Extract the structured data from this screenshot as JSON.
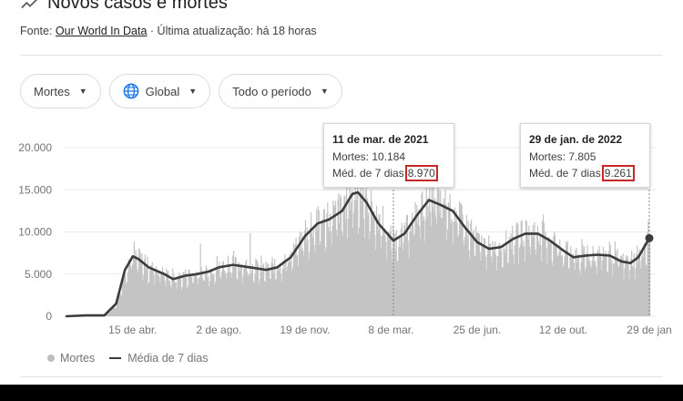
{
  "header": {
    "title": "Novos casos e mortes",
    "source_prefix": "Fonte:",
    "source_link": "Our World In Data",
    "source_suffix": "· Última atualização: há 18 horas",
    "icon": "trending-line-icon"
  },
  "filters": [
    {
      "label": "Mortes",
      "icon": ""
    },
    {
      "label": "Global",
      "icon": "globe-icon"
    },
    {
      "label": "Todo o período",
      "icon": ""
    }
  ],
  "colors": {
    "bars": "#c4c4c4",
    "line": "#3c3c3c",
    "highlight": "#c62828",
    "text": "#70757a"
  },
  "tooltips": [
    {
      "date": "11 de mar. de 2021",
      "line1_label": "Mortes:",
      "line1_value": "10.184",
      "line2_label": "Méd. de 7 dias",
      "line2_value": "8.970"
    },
    {
      "date": "29 de jan. de 2022",
      "line1_label": "Mortes:",
      "line1_value": "7.805",
      "line2_label": "Méd. de 7 dias",
      "line2_value": "9.261"
    }
  ],
  "legend": {
    "bars_label": "Mortes",
    "line_label": "Média de 7 dias"
  },
  "chart_data": {
    "type": "bar",
    "x_range": [
      "2020-01-22",
      "2022-01-29"
    ],
    "ylim": [
      0,
      20000
    ],
    "y_ticks": [
      "0",
      "5.000",
      "10.000",
      "15.000",
      "20.000"
    ],
    "x_ticks": [
      {
        "label": "15 de abr.",
        "date": "2020-04-15"
      },
      {
        "label": "2 de ago.",
        "date": "2020-08-02"
      },
      {
        "label": "19 de nov.",
        "date": "2020-11-19"
      },
      {
        "label": "8 de mar.",
        "date": "2021-03-08"
      },
      {
        "label": "25 de jun.",
        "date": "2021-06-25"
      },
      {
        "label": "12 de out.",
        "date": "2021-10-12"
      },
      {
        "label": "29 de jan",
        "date": "2022-01-29"
      }
    ],
    "grid": "horizontal",
    "series": [
      {
        "name": "Mortes",
        "type": "bar"
      },
      {
        "name": "Média de 7 dias",
        "type": "line",
        "points": [
          [
            "2020-01-22",
            0
          ],
          [
            "2020-02-15",
            100
          ],
          [
            "2020-03-10",
            100
          ],
          [
            "2020-03-25",
            1500
          ],
          [
            "2020-04-05",
            5500
          ],
          [
            "2020-04-15",
            7100
          ],
          [
            "2020-04-22",
            6800
          ],
          [
            "2020-05-05",
            5800
          ],
          [
            "2020-05-25",
            5000
          ],
          [
            "2020-06-05",
            4400
          ],
          [
            "2020-06-20",
            4800
          ],
          [
            "2020-07-05",
            5000
          ],
          [
            "2020-07-20",
            5300
          ],
          [
            "2020-08-02",
            5800
          ],
          [
            "2020-08-20",
            6100
          ],
          [
            "2020-09-10",
            5800
          ],
          [
            "2020-10-01",
            5500
          ],
          [
            "2020-10-15",
            5800
          ],
          [
            "2020-11-01",
            7000
          ],
          [
            "2020-11-19",
            9500
          ],
          [
            "2020-12-05",
            11000
          ],
          [
            "2020-12-20",
            11500
          ],
          [
            "2021-01-05",
            12500
          ],
          [
            "2021-01-18",
            14500
          ],
          [
            "2021-01-25",
            14700
          ],
          [
            "2021-02-05",
            13500
          ],
          [
            "2021-02-20",
            11000
          ],
          [
            "2021-03-11",
            8970
          ],
          [
            "2021-03-25",
            9800
          ],
          [
            "2021-04-10",
            12000
          ],
          [
            "2021-04-25",
            13800
          ],
          [
            "2021-05-10",
            13200
          ],
          [
            "2021-05-25",
            12500
          ],
          [
            "2021-06-10",
            10500
          ],
          [
            "2021-06-25",
            8800
          ],
          [
            "2021-07-10",
            8000
          ],
          [
            "2021-07-25",
            8200
          ],
          [
            "2021-08-10",
            9200
          ],
          [
            "2021-08-25",
            9800
          ],
          [
            "2021-09-10",
            9800
          ],
          [
            "2021-09-25",
            9000
          ],
          [
            "2021-10-12",
            7800
          ],
          [
            "2021-10-25",
            7000
          ],
          [
            "2021-11-10",
            7200
          ],
          [
            "2021-11-25",
            7300
          ],
          [
            "2021-12-10",
            7200
          ],
          [
            "2021-12-25",
            6500
          ],
          [
            "2022-01-05",
            6300
          ],
          [
            "2022-01-15",
            7000
          ],
          [
            "2022-01-29",
            9261
          ]
        ]
      }
    ],
    "tooltip_dates": [
      "2021-03-11",
      "2022-01-29"
    ],
    "legend_position": "bottom-left"
  }
}
